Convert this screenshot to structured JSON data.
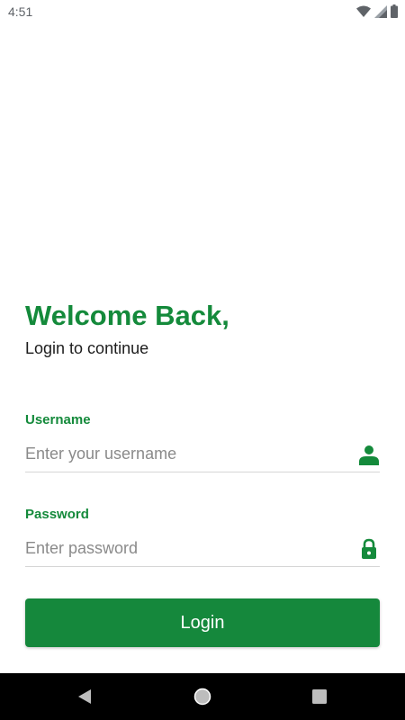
{
  "status_bar": {
    "time": "4:51",
    "icons": [
      "wifi-icon",
      "cellular-signal-icon",
      "battery-icon"
    ]
  },
  "login": {
    "title": "Welcome Back,",
    "subtitle": "Login to continue",
    "username": {
      "label": "Username",
      "value": "",
      "placeholder": "Enter your username",
      "icon": "person-icon"
    },
    "password": {
      "label": "Password",
      "value": "",
      "placeholder": "Enter password",
      "icon": "lock-icon"
    },
    "button_label": "Login"
  },
  "nav_bar": {
    "buttons": [
      "back-icon",
      "home-icon",
      "recents-icon"
    ]
  },
  "colors": {
    "accent": "#148a3b",
    "button": "#15883c",
    "placeholder": "#8a8a8a",
    "underline": "#d6d6d6"
  }
}
